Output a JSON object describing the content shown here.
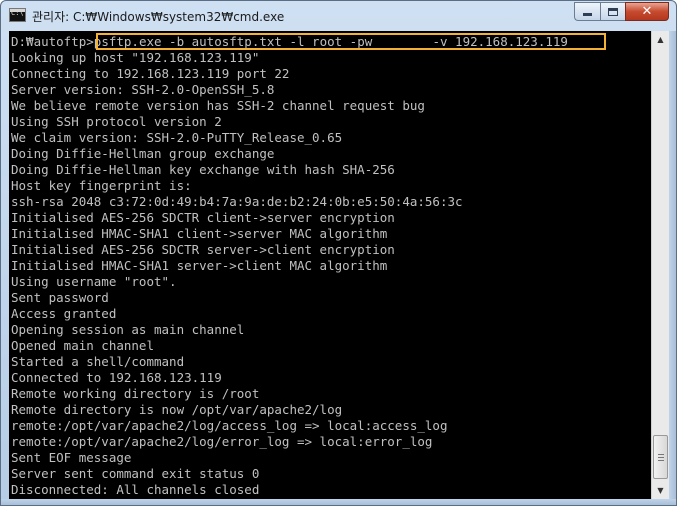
{
  "window": {
    "title": "관리자: C:₩Windows₩system32₩cmd.exe",
    "icon": "cmd-icon",
    "buttons": {
      "minimize": "minimize-icon",
      "maximize": "maximize-icon",
      "close": "✕"
    }
  },
  "console": {
    "prompt": "D:₩autoftp>",
    "command_part1": "psftp.exe -b autosftp.txt -l root -pw",
    "redacted_password": "██████",
    "command_part2": " -v 192.168.123.119",
    "lines": [
      "Looking up host \"192.168.123.119\"",
      "Connecting to 192.168.123.119 port 22",
      "Server version: SSH-2.0-OpenSSH_5.8",
      "We believe remote version has SSH-2 channel request bug",
      "Using SSH protocol version 2",
      "We claim version: SSH-2.0-PuTTY_Release_0.65",
      "Doing Diffie-Hellman group exchange",
      "Doing Diffie-Hellman key exchange with hash SHA-256",
      "Host key fingerprint is:",
      "ssh-rsa 2048 c3:72:0d:49:b4:7a:9a:de:b2:24:0b:e5:50:4a:56:3c",
      "Initialised AES-256 SDCTR client->server encryption",
      "Initialised HMAC-SHA1 client->server MAC algorithm",
      "Initialised AES-256 SDCTR server->client encryption",
      "Initialised HMAC-SHA1 server->client MAC algorithm",
      "Using username \"root\".",
      "Sent password",
      "Access granted",
      "Opening session as main channel",
      "Opened main channel",
      "Started a shell/command",
      "Connected to 192.168.123.119",
      "Remote working directory is /root",
      "Remote directory is now /opt/var/apache2/log",
      "remote:/opt/var/apache2/log/access_log => local:access_log",
      "remote:/opt/var/apache2/log/error_log => local:error_log",
      "Sent EOF message",
      "Server sent command exit status 0",
      "Disconnected: All channels closed"
    ]
  },
  "scrollbar": {
    "up": "▲",
    "down": "▼"
  },
  "colors": {
    "console_bg": "#000000",
    "console_fg": "#c0c0c0",
    "highlight": "#f3b233"
  }
}
